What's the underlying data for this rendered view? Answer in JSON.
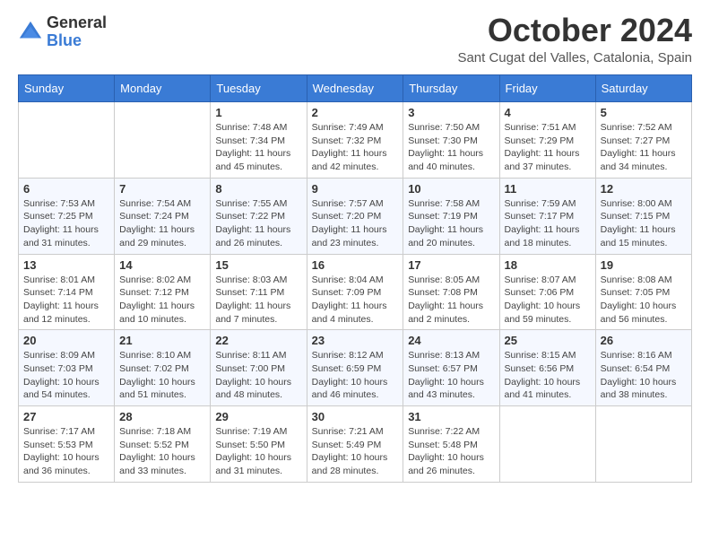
{
  "header": {
    "logo_general": "General",
    "logo_blue": "Blue",
    "month_title": "October 2024",
    "location": "Sant Cugat del Valles, Catalonia, Spain"
  },
  "days_of_week": [
    "Sunday",
    "Monday",
    "Tuesday",
    "Wednesday",
    "Thursday",
    "Friday",
    "Saturday"
  ],
  "weeks": [
    [
      {
        "day": "",
        "info": ""
      },
      {
        "day": "",
        "info": ""
      },
      {
        "day": "1",
        "info": "Sunrise: 7:48 AM\nSunset: 7:34 PM\nDaylight: 11 hours and 45 minutes."
      },
      {
        "day": "2",
        "info": "Sunrise: 7:49 AM\nSunset: 7:32 PM\nDaylight: 11 hours and 42 minutes."
      },
      {
        "day": "3",
        "info": "Sunrise: 7:50 AM\nSunset: 7:30 PM\nDaylight: 11 hours and 40 minutes."
      },
      {
        "day": "4",
        "info": "Sunrise: 7:51 AM\nSunset: 7:29 PM\nDaylight: 11 hours and 37 minutes."
      },
      {
        "day": "5",
        "info": "Sunrise: 7:52 AM\nSunset: 7:27 PM\nDaylight: 11 hours and 34 minutes."
      }
    ],
    [
      {
        "day": "6",
        "info": "Sunrise: 7:53 AM\nSunset: 7:25 PM\nDaylight: 11 hours and 31 minutes."
      },
      {
        "day": "7",
        "info": "Sunrise: 7:54 AM\nSunset: 7:24 PM\nDaylight: 11 hours and 29 minutes."
      },
      {
        "day": "8",
        "info": "Sunrise: 7:55 AM\nSunset: 7:22 PM\nDaylight: 11 hours and 26 minutes."
      },
      {
        "day": "9",
        "info": "Sunrise: 7:57 AM\nSunset: 7:20 PM\nDaylight: 11 hours and 23 minutes."
      },
      {
        "day": "10",
        "info": "Sunrise: 7:58 AM\nSunset: 7:19 PM\nDaylight: 11 hours and 20 minutes."
      },
      {
        "day": "11",
        "info": "Sunrise: 7:59 AM\nSunset: 7:17 PM\nDaylight: 11 hours and 18 minutes."
      },
      {
        "day": "12",
        "info": "Sunrise: 8:00 AM\nSunset: 7:15 PM\nDaylight: 11 hours and 15 minutes."
      }
    ],
    [
      {
        "day": "13",
        "info": "Sunrise: 8:01 AM\nSunset: 7:14 PM\nDaylight: 11 hours and 12 minutes."
      },
      {
        "day": "14",
        "info": "Sunrise: 8:02 AM\nSunset: 7:12 PM\nDaylight: 11 hours and 10 minutes."
      },
      {
        "day": "15",
        "info": "Sunrise: 8:03 AM\nSunset: 7:11 PM\nDaylight: 11 hours and 7 minutes."
      },
      {
        "day": "16",
        "info": "Sunrise: 8:04 AM\nSunset: 7:09 PM\nDaylight: 11 hours and 4 minutes."
      },
      {
        "day": "17",
        "info": "Sunrise: 8:05 AM\nSunset: 7:08 PM\nDaylight: 11 hours and 2 minutes."
      },
      {
        "day": "18",
        "info": "Sunrise: 8:07 AM\nSunset: 7:06 PM\nDaylight: 10 hours and 59 minutes."
      },
      {
        "day": "19",
        "info": "Sunrise: 8:08 AM\nSunset: 7:05 PM\nDaylight: 10 hours and 56 minutes."
      }
    ],
    [
      {
        "day": "20",
        "info": "Sunrise: 8:09 AM\nSunset: 7:03 PM\nDaylight: 10 hours and 54 minutes."
      },
      {
        "day": "21",
        "info": "Sunrise: 8:10 AM\nSunset: 7:02 PM\nDaylight: 10 hours and 51 minutes."
      },
      {
        "day": "22",
        "info": "Sunrise: 8:11 AM\nSunset: 7:00 PM\nDaylight: 10 hours and 48 minutes."
      },
      {
        "day": "23",
        "info": "Sunrise: 8:12 AM\nSunset: 6:59 PM\nDaylight: 10 hours and 46 minutes."
      },
      {
        "day": "24",
        "info": "Sunrise: 8:13 AM\nSunset: 6:57 PM\nDaylight: 10 hours and 43 minutes."
      },
      {
        "day": "25",
        "info": "Sunrise: 8:15 AM\nSunset: 6:56 PM\nDaylight: 10 hours and 41 minutes."
      },
      {
        "day": "26",
        "info": "Sunrise: 8:16 AM\nSunset: 6:54 PM\nDaylight: 10 hours and 38 minutes."
      }
    ],
    [
      {
        "day": "27",
        "info": "Sunrise: 7:17 AM\nSunset: 5:53 PM\nDaylight: 10 hours and 36 minutes."
      },
      {
        "day": "28",
        "info": "Sunrise: 7:18 AM\nSunset: 5:52 PM\nDaylight: 10 hours and 33 minutes."
      },
      {
        "day": "29",
        "info": "Sunrise: 7:19 AM\nSunset: 5:50 PM\nDaylight: 10 hours and 31 minutes."
      },
      {
        "day": "30",
        "info": "Sunrise: 7:21 AM\nSunset: 5:49 PM\nDaylight: 10 hours and 28 minutes."
      },
      {
        "day": "31",
        "info": "Sunrise: 7:22 AM\nSunset: 5:48 PM\nDaylight: 10 hours and 26 minutes."
      },
      {
        "day": "",
        "info": ""
      },
      {
        "day": "",
        "info": ""
      }
    ]
  ]
}
